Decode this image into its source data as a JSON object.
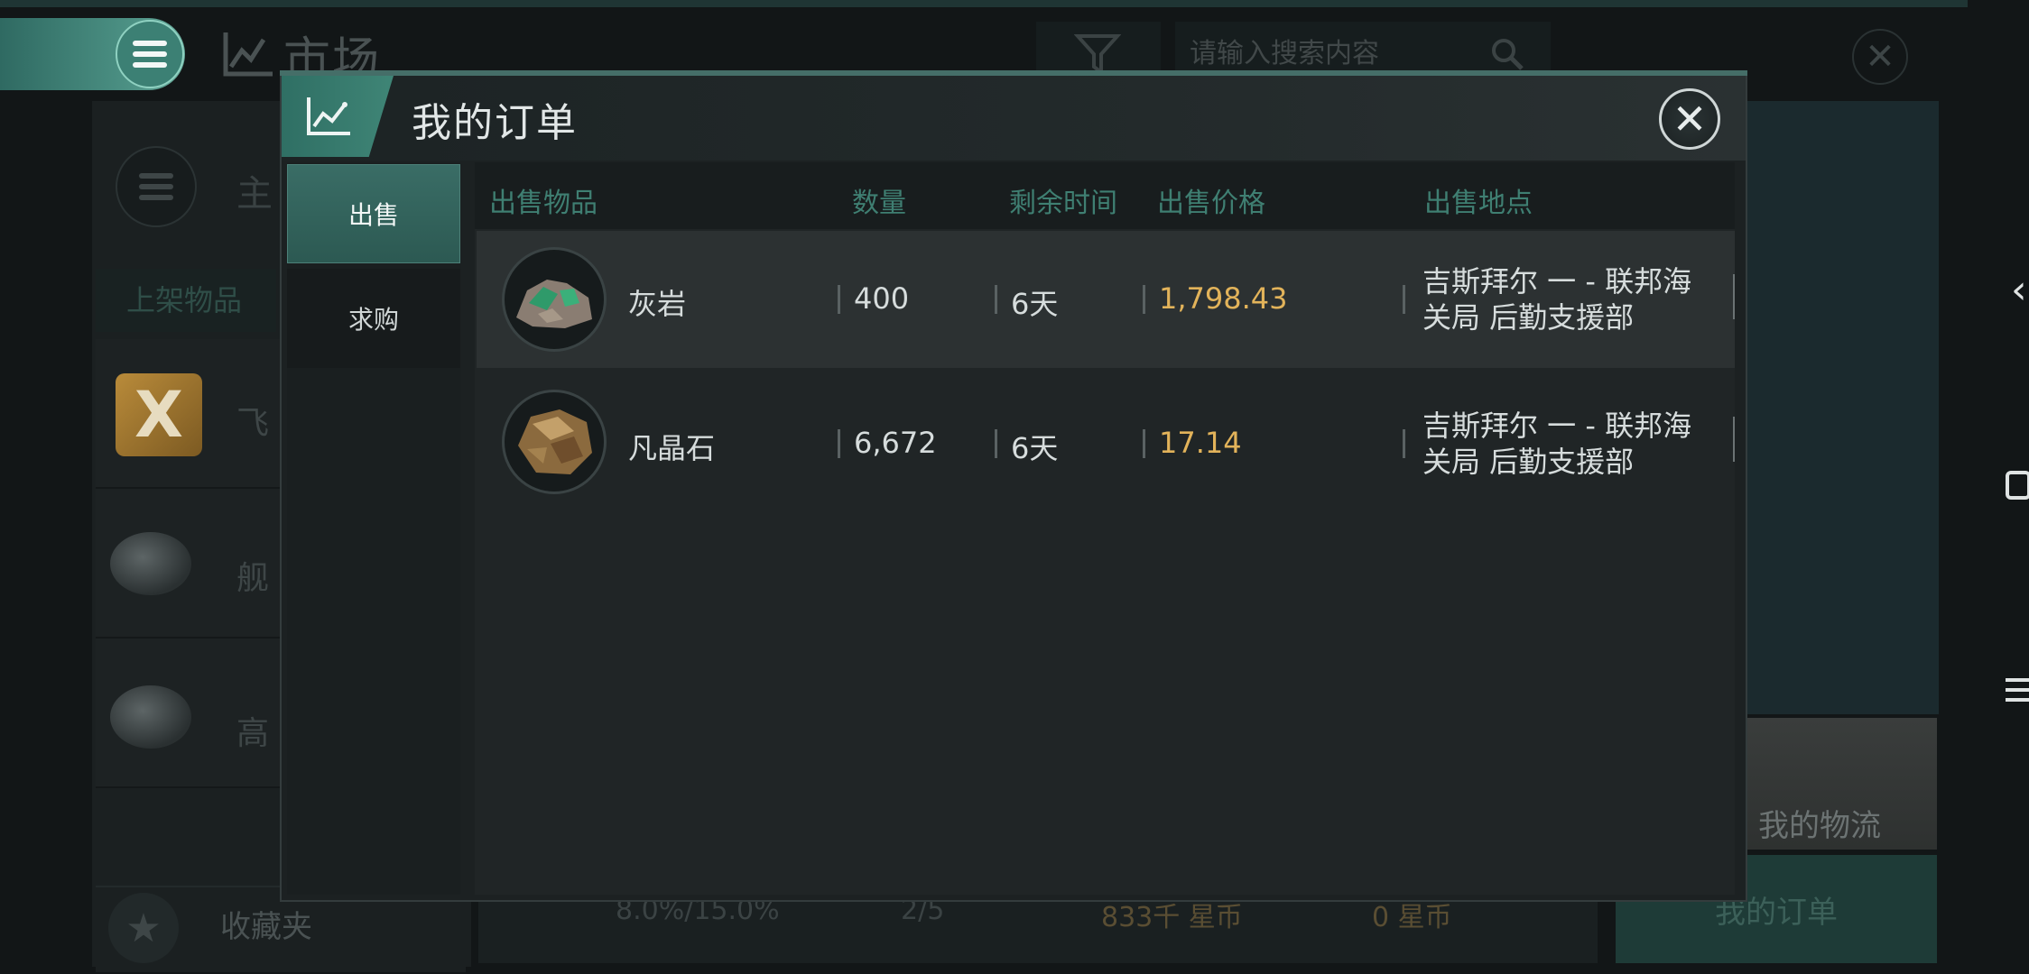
{
  "background": {
    "title": "市场",
    "search_placeholder": "请输入搜索内容",
    "left_header_text": "主",
    "left_tab": "上架物品",
    "left_items": [
      "飞",
      "舰",
      "高"
    ],
    "favorites": "收藏夹",
    "bottom_stats": [
      "8.0%/15.0%",
      "2/5",
      "833千 星币",
      "0 星币"
    ],
    "my_logistics": "我的物流",
    "my_orders": "我的订单"
  },
  "modal": {
    "title": "我的订单",
    "tabs": {
      "sell": "出售",
      "buy": "求购"
    },
    "columns": {
      "item": "出售物品",
      "quantity": "数量",
      "remaining": "剩余时间",
      "price": "出售价格",
      "location": "出售地点"
    },
    "rows": [
      {
        "name": "灰岩",
        "quantity": "400",
        "remaining": "6天",
        "price": "1,798.43",
        "location_line1": "吉斯拜尔 一 - 联邦海",
        "location_line2": "关局 后勤支援部"
      },
      {
        "name": "凡晶石",
        "quantity": "6,672",
        "remaining": "6天",
        "price": "17.14",
        "location_line1": "吉斯拜尔 一 - 联邦海",
        "location_line2": "关局 后勤支援部"
      }
    ]
  },
  "colors": {
    "accent": "#3f8576",
    "price": "#e2b35a",
    "header_text": "#3f7f72"
  },
  "icons": [
    "menu-icon",
    "market-chart-icon",
    "filter-icon",
    "search-icon",
    "close-icon",
    "star-icon",
    "back-icon",
    "home-icon",
    "recents-icon"
  ]
}
